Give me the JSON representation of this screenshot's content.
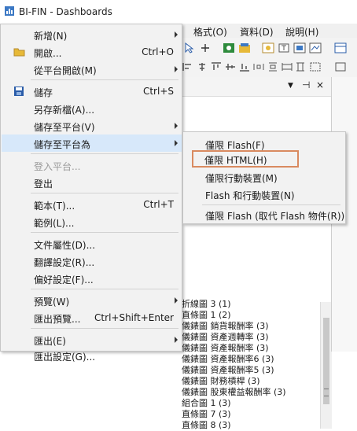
{
  "window": {
    "title": "BI-FIN - Dashboards"
  },
  "menubar": {
    "items": [
      "格式(O)",
      "資料(D)",
      "說明(H)"
    ]
  },
  "context_menu": {
    "items": [
      {
        "label": "新增(N)",
        "shortcut": "",
        "submenu": true,
        "icon": ""
      },
      {
        "label": "開啟...",
        "shortcut": "Ctrl+O",
        "submenu": false,
        "icon": "folder-open-icon"
      },
      {
        "label": "從平台開啟(M)",
        "shortcut": "",
        "submenu": true,
        "icon": ""
      },
      {
        "label": "儲存",
        "shortcut": "Ctrl+S",
        "submenu": false,
        "icon": "save-icon"
      },
      {
        "label": "另存新檔(A)...",
        "shortcut": "",
        "submenu": false,
        "icon": ""
      },
      {
        "label": "儲存至平台(V)",
        "shortcut": "",
        "submenu": true,
        "icon": ""
      },
      {
        "label": "儲存至平台為",
        "shortcut": "",
        "submenu": true,
        "icon": ""
      },
      {
        "label": "登入平台...",
        "shortcut": "",
        "submenu": false,
        "icon": ""
      },
      {
        "label": "登出",
        "shortcut": "",
        "submenu": false,
        "icon": ""
      },
      {
        "label": "範本(T)...",
        "shortcut": "Ctrl+T",
        "submenu": false,
        "icon": ""
      },
      {
        "label": "範例(L)...",
        "shortcut": "",
        "submenu": false,
        "icon": ""
      },
      {
        "label": "文件屬性(D)...",
        "shortcut": "",
        "submenu": false,
        "icon": ""
      },
      {
        "label": "翻譯設定(R)...",
        "shortcut": "",
        "submenu": false,
        "icon": ""
      },
      {
        "label": "偏好設定(F)...",
        "shortcut": "",
        "submenu": false,
        "icon": ""
      },
      {
        "label": "預覽(W)",
        "shortcut": "",
        "submenu": true,
        "icon": ""
      },
      {
        "label": "匯出預覽...",
        "shortcut": "Ctrl+Shift+Enter",
        "submenu": false,
        "icon": ""
      },
      {
        "label": "匯出(E)",
        "shortcut": "",
        "submenu": true,
        "icon": ""
      },
      {
        "label": "匯出設定(G)...",
        "shortcut": "",
        "submenu": false,
        "icon": ""
      }
    ],
    "highlighted": "儲存至平台為",
    "disabled": [
      "登入平台..."
    ]
  },
  "submenu": {
    "items": [
      {
        "label": "僅限 Flash(F)"
      },
      {
        "label": "僅限 HTML(H)"
      },
      {
        "label": "僅限行動裝置(M)"
      },
      {
        "label": "Flash 和行動裝置(N)"
      },
      {
        "label": "僅限 Flash (取代 Flash 物件(R))"
      }
    ],
    "outlined": "僅限 HTML(H)"
  },
  "panel": {
    "rows": [
      "折線圖 3 (1)",
      "直條圖 1 (2)",
      "儀錶圖 銷貨報酬率 (3)",
      "儀錶圖 資產週轉率 (3)",
      "儀錶圖 資產報酬率 (3)",
      "儀錶圖 資產報酬率6 (3)",
      "儀錶圖 資產報酬率5 (3)",
      "儀錶圖 財務槓桿 (3)",
      "儀錶圖 股東權益報酬率 (3)",
      "組合圖 1 (3)",
      "直條圖 7 (3)",
      "直條圖 8 (3)"
    ]
  },
  "colors": {
    "menu_bg": "#f2f2f2",
    "highlight": "#d7e8fa",
    "outline": "#d98a60",
    "disabled_text": "#9a9a9a"
  }
}
